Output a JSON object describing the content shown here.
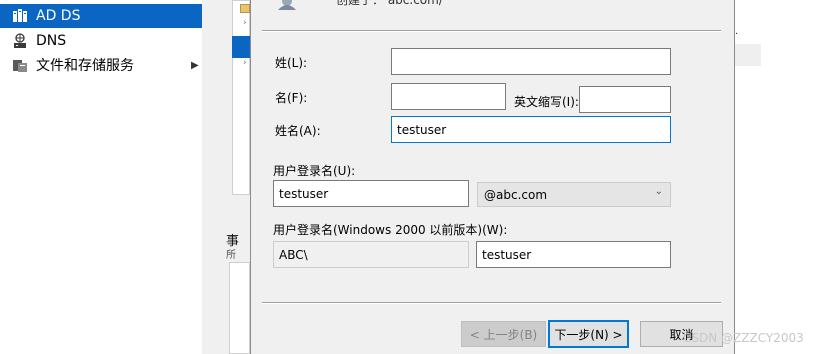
{
  "nav": {
    "items": [
      {
        "label": "AD DS",
        "icon": "ad-ds-icon"
      },
      {
        "label": "DNS",
        "icon": "dns-icon"
      },
      {
        "label": "文件和存储服务",
        "icon": "file-storage-icon",
        "has_submenu": true
      }
    ],
    "selected_index": 0
  },
  "background": {
    "events_label": "事",
    "all_label": "所",
    "right_snippet": "."
  },
  "dialog": {
    "header_text": "创建于：  abc.com/",
    "last_name_label": "姓(L):",
    "last_name_value": "",
    "first_name_label": "名(F):",
    "first_name_value": "",
    "initials_label": "英文缩写(I):",
    "initials_value": "",
    "full_name_label": "姓名(A):",
    "full_name_value": "testuser",
    "logon_label": "用户登录名(U):",
    "logon_value": "testuser",
    "domain_suffix": "@abc.com",
    "pre2000_label": "用户登录名(Windows 2000 以前版本)(W):",
    "pre2000_domain": "ABC\\",
    "pre2000_value": "testuser",
    "back_button": "< 上一步(B)",
    "next_button": "下一步(N) >",
    "cancel_button": "取消"
  },
  "watermark": "CSDN @ZZZCY2003",
  "colors": {
    "accent": "#0a66c2",
    "focus_border": "#0078d7",
    "dialog_bg": "#f0f0f0"
  }
}
